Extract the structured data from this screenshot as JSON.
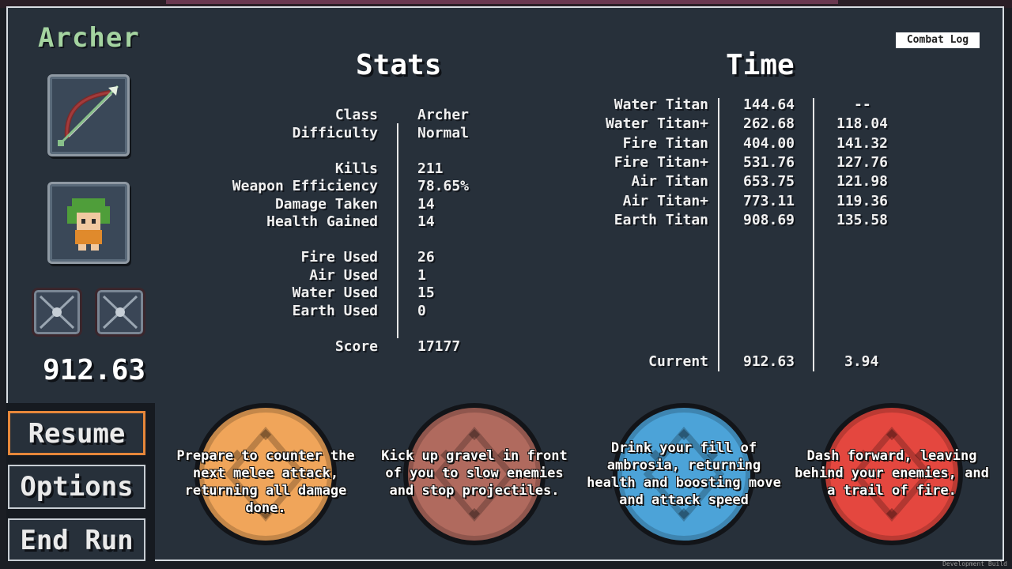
{
  "character": {
    "name": "Archer",
    "timer": "912.63"
  },
  "combat_log_label": "Combat Log",
  "stats": {
    "heading": "Stats",
    "groups": [
      [
        {
          "label": "Class",
          "value": "Archer"
        },
        {
          "label": "Difficulty",
          "value": "Normal"
        }
      ],
      [
        {
          "label": "Kills",
          "value": "211"
        },
        {
          "label": "Weapon Efficiency",
          "value": "78.65%"
        },
        {
          "label": "Damage Taken",
          "value": "14"
        },
        {
          "label": "Health Gained",
          "value": "14"
        }
      ],
      [
        {
          "label": "Fire Used",
          "value": "26"
        },
        {
          "label": "Air Used",
          "value": "1"
        },
        {
          "label": "Water Used",
          "value": "15"
        },
        {
          "label": "Earth Used",
          "value": "0"
        }
      ],
      [
        {
          "label": "Score",
          "value": "17177"
        }
      ]
    ]
  },
  "time": {
    "heading": "Time",
    "rows": [
      {
        "name": "Water Titan",
        "total": "144.64",
        "split": "--"
      },
      {
        "name": "Water Titan+",
        "total": "262.68",
        "split": "118.04"
      },
      {
        "name": "Fire Titan",
        "total": "404.00",
        "split": "141.32"
      },
      {
        "name": "Fire Titan+",
        "total": "531.76",
        "split": "127.76"
      },
      {
        "name": "Air Titan",
        "total": "653.75",
        "split": "121.98"
      },
      {
        "name": "Air Titan+",
        "total": "773.11",
        "split": "119.36"
      },
      {
        "name": "Earth Titan",
        "total": "908.69",
        "split": "135.58"
      }
    ],
    "current": {
      "name": "Current",
      "total": "912.63",
      "split": "3.94"
    }
  },
  "menu": {
    "resume": "Resume",
    "options": "Options",
    "end_run": "End Run"
  },
  "abilities": [
    {
      "element": "earth",
      "color": "#f0a55a",
      "text": "Prepare to counter the next melee attack, returning all damage done."
    },
    {
      "element": "stone",
      "color": "#b06a5e",
      "text": "Kick up gravel in front of you to slow enemies and stop projectiles."
    },
    {
      "element": "water",
      "color": "#4ca3d8",
      "text": "Drink your fill of ambrosia, returning health and boosting move and attack speed"
    },
    {
      "element": "fire",
      "color": "#e4473f",
      "text": "Dash forward, leaving behind your enemies, and a trail of fire."
    }
  ],
  "footer": {
    "dev_build": "Development Build"
  }
}
